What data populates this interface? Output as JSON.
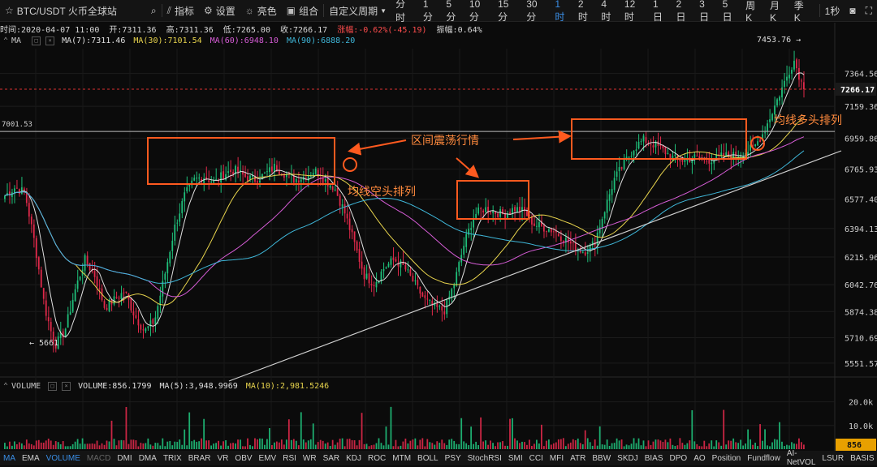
{
  "toolbar": {
    "symbol": "BTC/USDT 火币全球站",
    "indicators_label": "指标",
    "settings_label": "设置",
    "theme_label": "亮色",
    "combine_label": "组合",
    "custom_period_label": "自定义周期",
    "intervals": [
      "分时",
      "1分",
      "5分",
      "10分",
      "15分",
      "30分",
      "1时",
      "2时",
      "4时",
      "12时",
      "1日",
      "2日",
      "3日",
      "5日",
      "周K",
      "月K",
      "季K"
    ],
    "active_interval": "1时",
    "refresh_label": "1秒"
  },
  "info": {
    "time": "时间:2020-04-07 11:00",
    "open": "开:7311.36",
    "high": "高:7311.36",
    "low": "低:7265.00",
    "close": "收:7266.17",
    "change": "涨幅:-0.62%(-45.19)",
    "amplitude": "振幅:0.64%"
  },
  "ma_legend": {
    "label": "MA",
    "items": [
      {
        "text": "MA(7):7311.46",
        "color": "#e0e0e0"
      },
      {
        "text": "MA(30):7101.54",
        "color": "#e8d44d"
      },
      {
        "text": "MA(60):6948.10",
        "color": "#d65cd6"
      },
      {
        "text": "MA(90):6888.20",
        "color": "#3fb7d9"
      }
    ]
  },
  "vol_legend": {
    "label": "VOLUME",
    "items": [
      {
        "text": "VOLUME:856.1799",
        "color": "#e0e0e0"
      },
      {
        "text": "MA(5):3,948.9969",
        "color": "#e0e0e0"
      },
      {
        "text": "MA(10):2,981.5246",
        "color": "#e8d44d"
      }
    ]
  },
  "indicator_tabs": [
    "MA",
    "EMA",
    "VOLUME",
    "MACD",
    "DMI",
    "DMA",
    "TRIX",
    "BRAR",
    "VR",
    "OBV",
    "EMV",
    "RSI",
    "WR",
    "SAR",
    "KDJ",
    "ROC",
    "MTM",
    "BOLL",
    "PSY",
    "StochRSI",
    "SMI",
    "CCI",
    "MFI",
    "ATR",
    "BBW",
    "SKDJ",
    "BIAS",
    "DPO",
    "AO",
    "Position",
    "Fundflow",
    "AI-NetVOL",
    "LSUR",
    "BASIS"
  ],
  "active_indicator_tabs": [
    "MA",
    "VOLUME"
  ],
  "dim_indicator_tabs": [
    "MACD"
  ],
  "chart_data": {
    "type": "candlestick",
    "price_axis_ticks": [
      "7364.56",
      "7159.36",
      "6959.86",
      "6765.93",
      "6577.40",
      "6394.13",
      "6215.96",
      "6042.76",
      "5874.38",
      "5710.69",
      "5551.57"
    ],
    "last_price_label": "7266.17",
    "reference_price_label": "7001.53",
    "high_marker": "7453.76",
    "low_marker": "5661",
    "volume_axis_ticks": [
      "20.0k",
      "10.0k"
    ],
    "last_volume_label": "856",
    "series_colors": {
      "up": "#1fbf7a",
      "down": "#e0294a",
      "ma7": "#e0e0e0",
      "ma30": "#e8d44d",
      "ma60": "#d65cd6",
      "ma90": "#3fb7d9"
    },
    "annotations": [
      {
        "text": "区间震荡行情",
        "color": "#ff8a3d"
      },
      {
        "text": "均线空头排列",
        "color": "#ff8a3d"
      },
      {
        "text": "均线多头排列",
        "color": "#ff8a3d"
      }
    ],
    "close_path": [
      6600,
      6650,
      6620,
      6300,
      5900,
      5661,
      5750,
      6000,
      6200,
      6100,
      5900,
      5950,
      6000,
      5850,
      5750,
      5820,
      6100,
      6400,
      6600,
      6700,
      6720,
      6680,
      6740,
      6760,
      6720,
      6700,
      6730,
      6780,
      6740,
      6700,
      6720,
      6760,
      6700,
      6650,
      6500,
      6300,
      6100,
      6050,
      6150,
      6200,
      6150,
      6050,
      5950,
      5900,
      5880,
      6050,
      6300,
      6480,
      6520,
      6500,
      6480,
      6520,
      6500,
      6420,
      6400,
      6380,
      6330,
      6280,
      6250,
      6300,
      6500,
      6700,
      6800,
      6900,
      6950,
      6920,
      6880,
      6830,
      6820,
      6840,
      6820,
      6830,
      6850,
      6850,
      6870,
      6900,
      7000,
      7150,
      7300,
      7450,
      7266
    ]
  }
}
